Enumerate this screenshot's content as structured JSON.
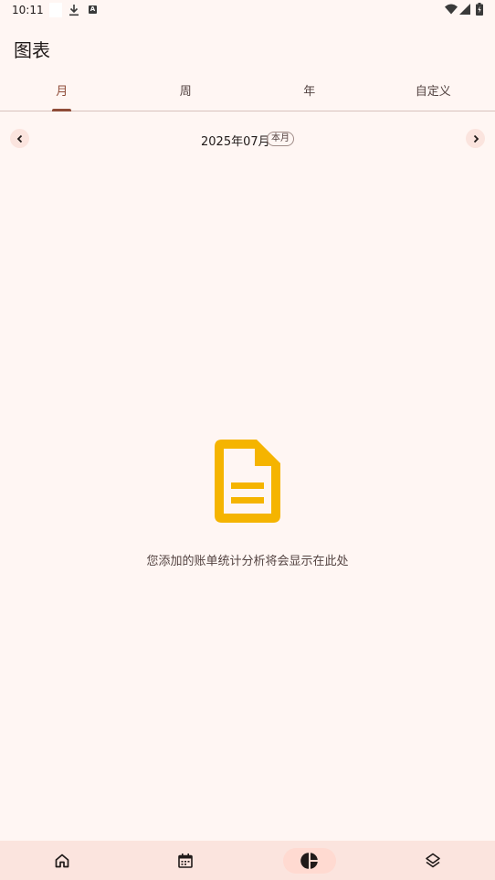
{
  "status_bar": {
    "time": "10:11",
    "icons": [
      "download-icon",
      "a-badge-icon",
      "wifi-icon",
      "signal-icon",
      "battery-icon"
    ]
  },
  "header": {
    "title": "图表"
  },
  "tabs": [
    {
      "label": "月",
      "active": true
    },
    {
      "label": "周",
      "active": false
    },
    {
      "label": "年",
      "active": false
    },
    {
      "label": "自定义",
      "active": false
    }
  ],
  "period": {
    "label": "2025年07月",
    "this_month_chip": "本月",
    "prev_icon": "chevron-left-icon",
    "next_icon": "chevron-right-icon"
  },
  "empty_state": {
    "icon": "document-icon",
    "message": "您添加的账单统计分析将会显示在此处"
  },
  "bottom_nav": [
    {
      "icon": "home-icon",
      "active": false
    },
    {
      "icon": "calendar-icon",
      "active": false
    },
    {
      "icon": "pie-chart-icon",
      "active": true
    },
    {
      "icon": "layers-icon",
      "active": false
    }
  ],
  "colors": {
    "background": "#fff6f3",
    "accent": "#8f4c38",
    "empty_icon": "#f5b400",
    "nav_background": "#fbe4de",
    "nav_active_pill": "#ffdad1"
  }
}
